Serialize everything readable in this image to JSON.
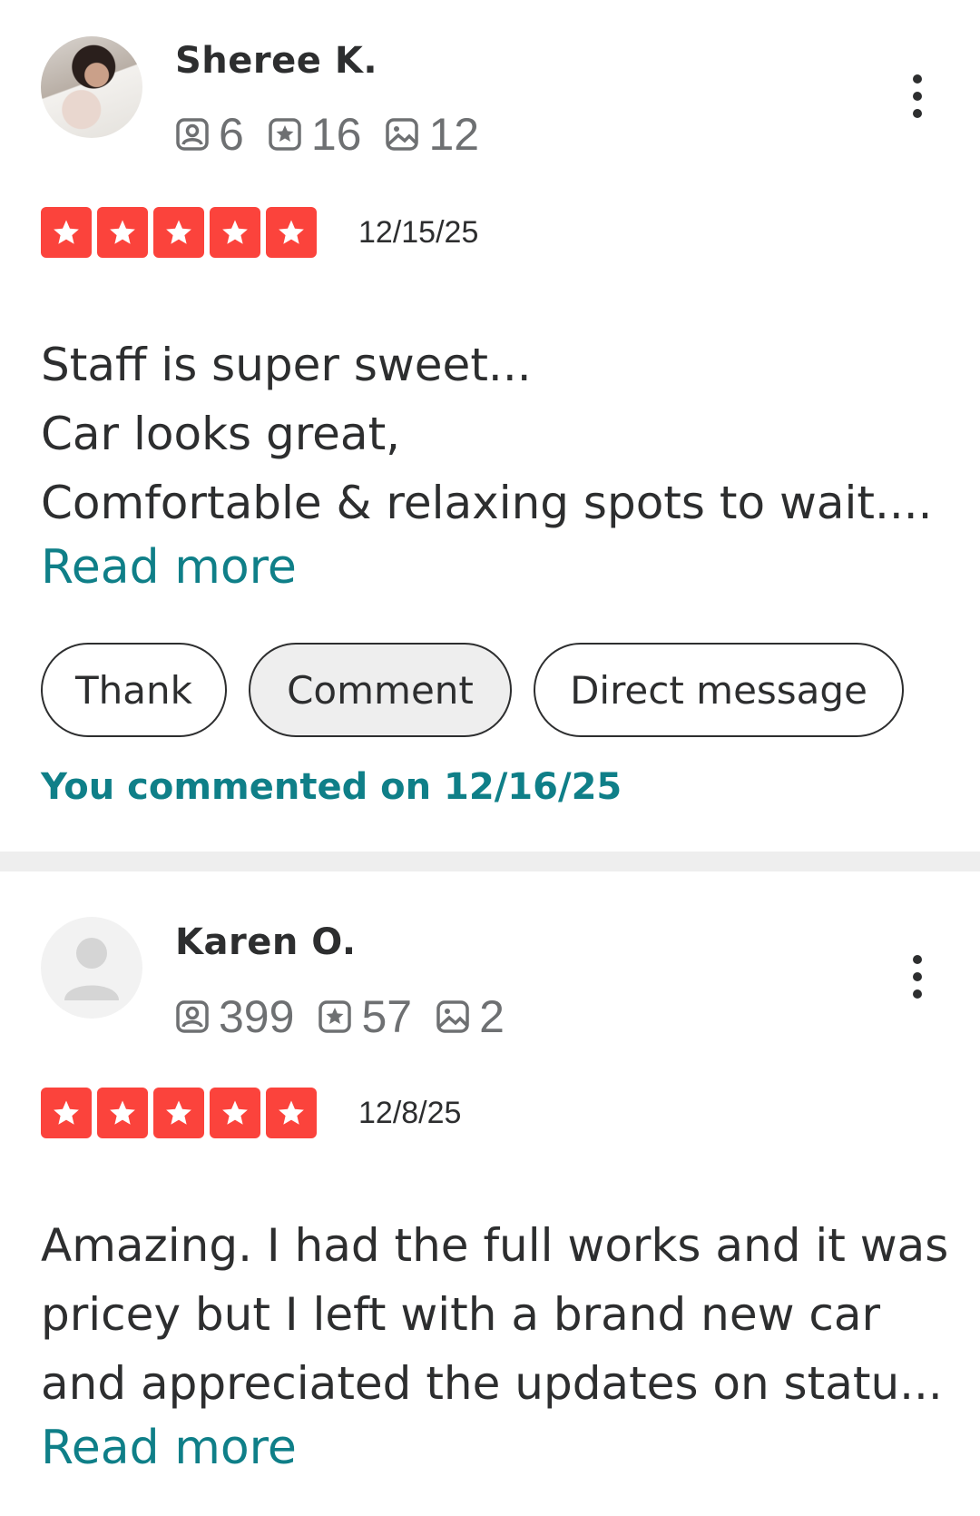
{
  "reviews": [
    {
      "name": "Sheree K.",
      "stats": {
        "friends": "6",
        "reviews": "16",
        "photos": "12"
      },
      "rating": 5,
      "date": "12/15/25",
      "lines": [
        "Staff is super sweet...",
        "Car looks great,",
        "Comfortable & relaxing spots to wait...."
      ],
      "read_more": "Read more",
      "actions": {
        "thank": "Thank",
        "comment": "Comment",
        "direct_message": "Direct message"
      },
      "commented_note": "You commented on 12/16/25"
    },
    {
      "name": "Karen O.",
      "stats": {
        "friends": "399",
        "reviews": "57",
        "photos": "2"
      },
      "rating": 5,
      "date": "12/8/25",
      "lines": [
        "Amazing. I had the full works and it was",
        "pricey but I left with a brand new car",
        "and appreciated the updates on statu..."
      ],
      "read_more": "Read more"
    }
  ],
  "colors": {
    "star": "#fb433c",
    "link": "#0f7f88",
    "text": "#2d2e2f"
  },
  "icons": [
    "friends-icon",
    "reviews-icon",
    "photos-icon",
    "star-icon",
    "more-options-icon",
    "user-placeholder-icon"
  ]
}
